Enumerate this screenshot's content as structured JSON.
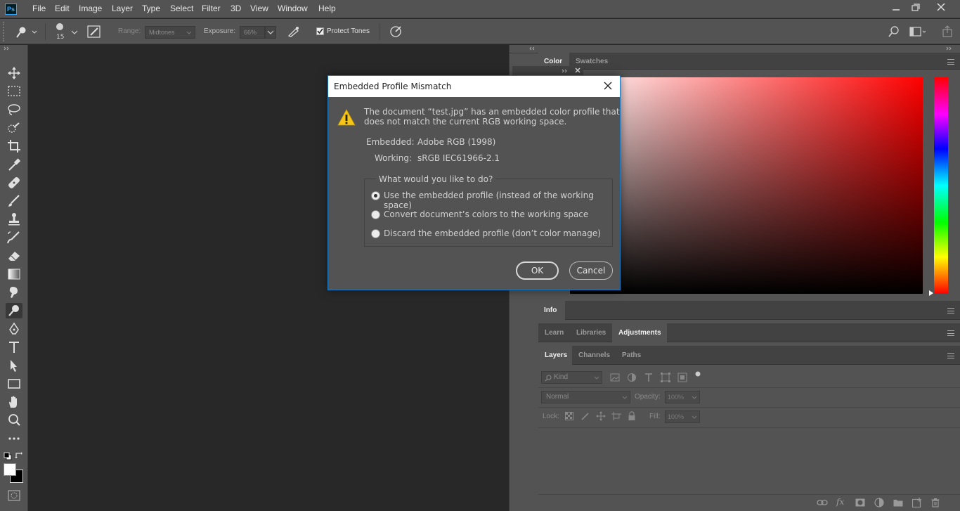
{
  "app": {
    "logo": "Ps"
  },
  "menu": [
    "File",
    "Edit",
    "Image",
    "Layer",
    "Type",
    "Select",
    "Filter",
    "3D",
    "View",
    "Window",
    "Help"
  ],
  "options": {
    "brush_size": "15",
    "range_label": "Range:",
    "range_value": "Midtones",
    "exposure_label": "Exposure:",
    "exposure_value": "66%",
    "protect_tones_label": "Protect Tones",
    "protect_tones_checked": true
  },
  "color_panel": {
    "tabs": [
      "Color",
      "Swatches"
    ],
    "active": "Color",
    "hue_color": "#ff0000"
  },
  "info_panel": {
    "tabs": [
      "Info"
    ]
  },
  "learn_panel": {
    "tabs": [
      "Learn",
      "Libraries",
      "Adjustments"
    ],
    "active": "Adjustments"
  },
  "layers_panel": {
    "tabs": [
      "Layers",
      "Channels",
      "Paths"
    ],
    "active": "Layers",
    "kind_placeholder": "Kind",
    "blend_mode": "Normal",
    "opacity_label": "Opacity:",
    "opacity_value": "100%",
    "lock_label": "Lock:",
    "fill_label": "Fill:",
    "fill_value": "100%"
  },
  "dialog": {
    "title": "Embedded Profile Mismatch",
    "message_line1": "The document “test.jpg” has an embedded color profile that",
    "message_line2": "does not match the current RGB working space.",
    "embedded_label": "Embedded:",
    "embedded_value": "Adobe RGB (1998)",
    "working_label": "Working:",
    "working_value": "sRGB IEC61966-2.1",
    "group_title": "What would you like to do?",
    "options": [
      {
        "label": "Use the embedded profile (instead of the working space)",
        "checked": true
      },
      {
        "label": "Convert document’s colors to the working space",
        "checked": false
      },
      {
        "label": "Discard the embedded profile (don’t color manage)",
        "checked": false
      }
    ],
    "ok_label": "OK",
    "cancel_label": "Cancel"
  }
}
